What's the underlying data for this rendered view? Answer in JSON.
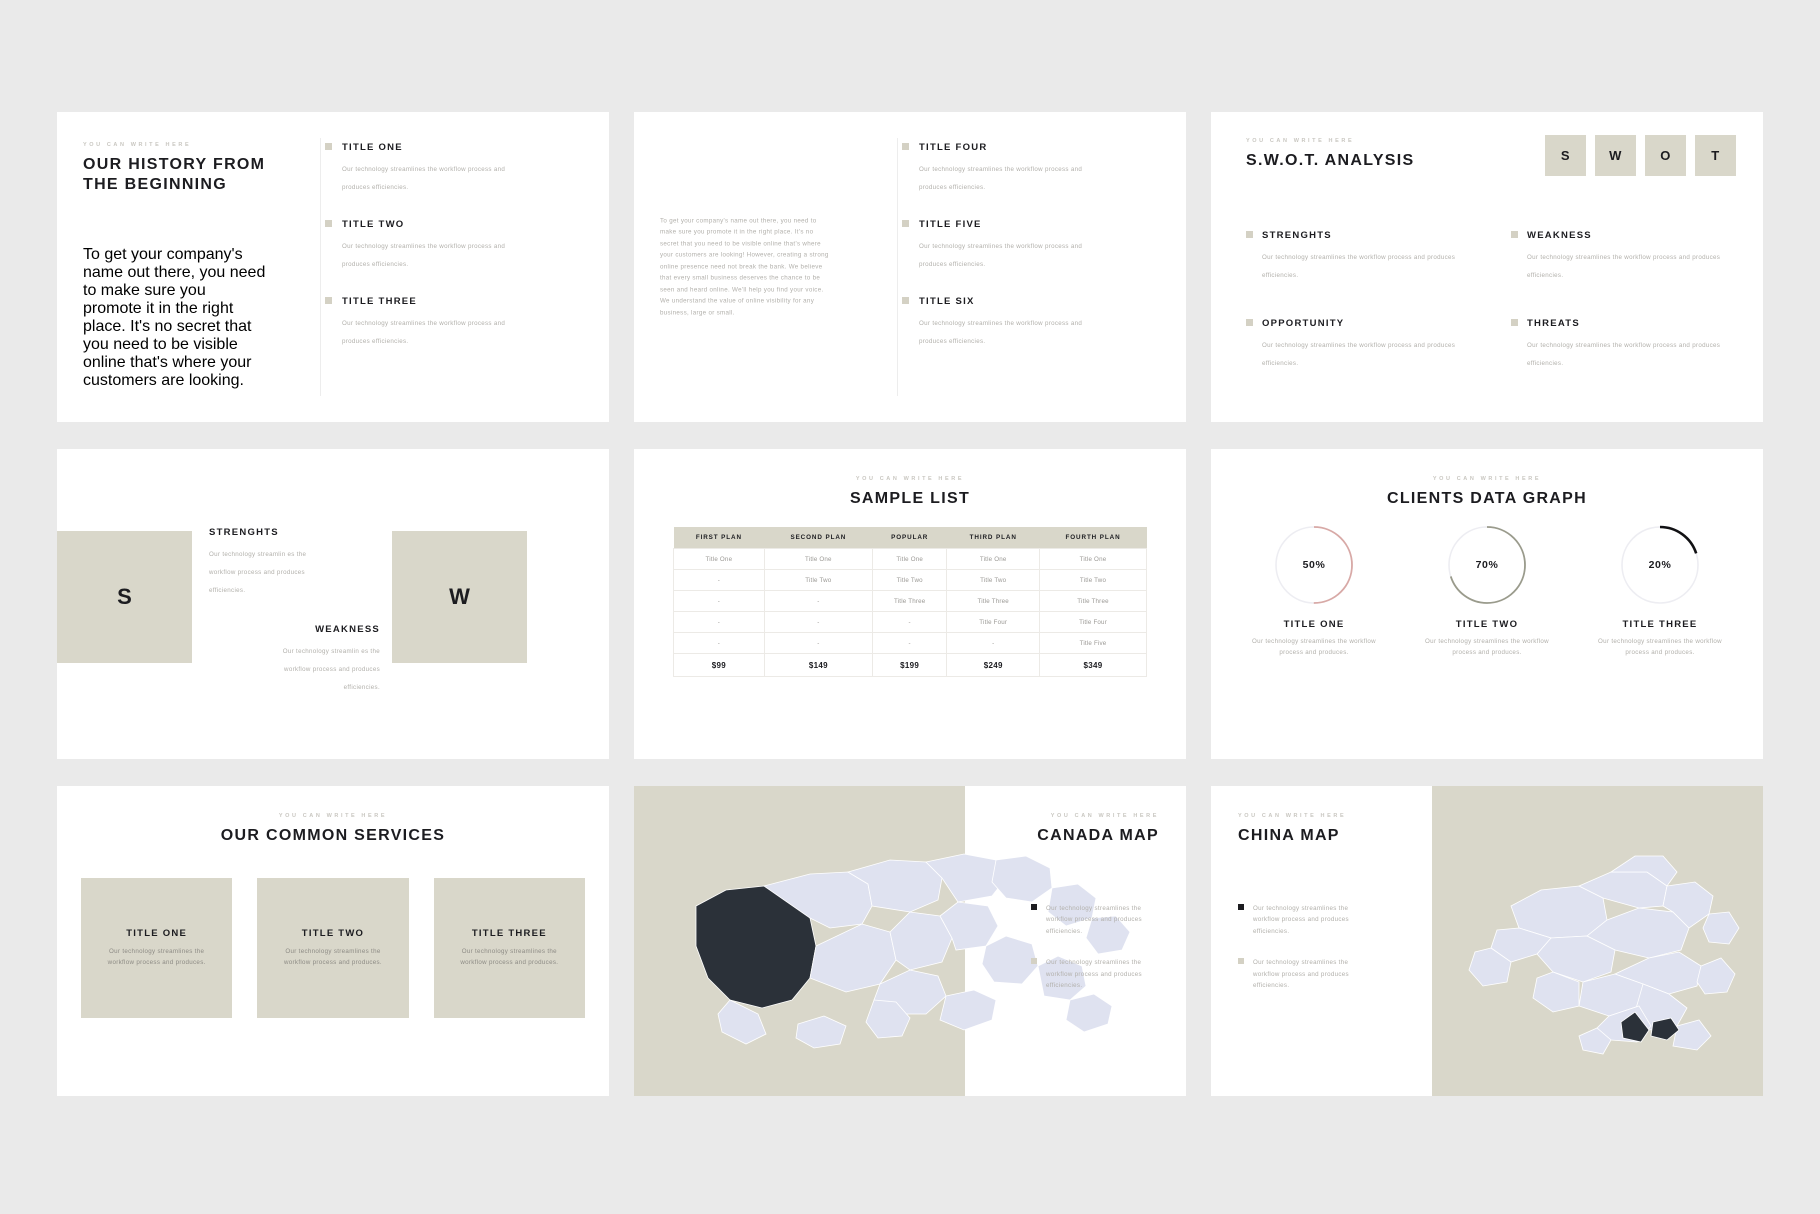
{
  "common": {
    "eyebrow": "YOU CAN WRITE HERE",
    "desc_short": "Our technology streamlines the workflow process and produces efficiencies.",
    "desc_nodot": "Our technology streamlines the workflow process and produces.",
    "desc_wrap": "Our technology streamlin es the workflow process and produces efficiencies.",
    "accent_beige": "#d9d7ca",
    "accent_dark": "#1c1c20",
    "text_muted": "#b2b0ab",
    "map_fill": "#dfe2f0"
  },
  "slide1": {
    "eyebrow": "YOU CAN WRITE HERE",
    "title": "OUR HISTORY FROM THE BEGINNING",
    "paragraph": "To get your company's name out there, you need to make sure you promote it in the right place. It's no secret that you need to be visible online that's where your customers are looking.",
    "features": [
      {
        "title": "TITLE ONE",
        "desc": "Our technology streamlines the workflow process and produces efficiencies."
      },
      {
        "title": "TITLE TWO",
        "desc": "Our technology streamlines the workflow process and produces efficiencies."
      },
      {
        "title": "TITLE THREE",
        "desc": "Our technology streamlines the workflow process and produces efficiencies."
      }
    ]
  },
  "slide2": {
    "paragraph": "To get your company's name out there, you need to make sure you promote it in the right place. It's no secret that you need to be visible online that's where your customers are looking! However, creating a strong online presence need not break the bank. We believe that every small business deserves the chance to be seen and heard online. We'll help you find your voice. We understand the value of online visibility for any business, large or small.",
    "features": [
      {
        "title": "TITLE FOUR",
        "desc": "Our technology streamlines the workflow process and produces efficiencies."
      },
      {
        "title": "TITLE FIVE",
        "desc": "Our technology streamlines the workflow process and produces efficiencies."
      },
      {
        "title": "TITLE SIX",
        "desc": "Our technology streamlines the workflow process and produces efficiencies."
      }
    ]
  },
  "slide3": {
    "eyebrow": "YOU CAN WRITE HERE",
    "title": "S.W.O.T. ANALYSIS",
    "boxes": [
      "S",
      "W",
      "O",
      "T"
    ],
    "cells": [
      {
        "title": "STRENGHTS",
        "desc": "Our technology streamlines the workflow process and produces efficiencies."
      },
      {
        "title": "WEAKNESS",
        "desc": "Our technology streamlines the workflow process and produces efficiencies."
      },
      {
        "title": "OPPORTUNITY",
        "desc": "Our technology streamlines the workflow process and produces efficiencies."
      },
      {
        "title": "THREATS",
        "desc": "Our technology streamlines the workflow process and produces efficiencies."
      }
    ]
  },
  "slide4": {
    "letter_a": "S",
    "letter_b": "W",
    "block_a": {
      "title": "STRENGHTS",
      "desc": "Our technology streamlin es the workflow process and produces efficiencies."
    },
    "block_b": {
      "title": "WEAKNESS",
      "desc": "Our technology streamlin es the workflow process and produces efficiencies."
    }
  },
  "slide5": {
    "eyebrow": "YOU CAN WRITE HERE",
    "title": "SAMPLE LIST",
    "table": {
      "headers": [
        "FIRST PLAN",
        "SECOND PLAN",
        "POPULAR",
        "THIRD PLAN",
        "FOURTH PLAN"
      ],
      "rows": [
        [
          "Title One",
          "Title One",
          "Title One",
          "Title One",
          "Title One"
        ],
        [
          "-",
          "Title Two",
          "Title Two",
          "Title Two",
          "Title Two"
        ],
        [
          "-",
          "-",
          "Title Three",
          "Title Three",
          "Title Three"
        ],
        [
          "-",
          "-",
          "-",
          "Title Four",
          "Title Four"
        ],
        [
          "-",
          "-",
          "-",
          "-",
          "Title Five"
        ]
      ],
      "prices": [
        "$99",
        "$149",
        "$199",
        "$249",
        "$349"
      ]
    }
  },
  "slide6": {
    "eyebrow": "YOU CAN WRITE HERE",
    "title": "CLIENTS DATA GRAPH",
    "chart_data": {
      "type": "pie",
      "title": "CLIENTS DATA GRAPH",
      "categories": [
        "TITLE ONE",
        "TITLE TWO",
        "TITLE THREE"
      ],
      "values": [
        50,
        70,
        20
      ],
      "value_labels": [
        "50%",
        "70%",
        "20%"
      ],
      "arc_colors": [
        "#d8a9a6",
        "#9a9b8c",
        "#111114"
      ],
      "track_color": "#ededf2",
      "ylim": [
        0,
        100
      ],
      "legend": "none",
      "grid": false
    },
    "items": [
      {
        "label": "TITLE ONE",
        "value": "50%",
        "desc": "Our technology streamlines the workflow process and produces."
      },
      {
        "label": "TITLE TWO",
        "value": "70%",
        "desc": "Our technology streamlines the workflow process and produces."
      },
      {
        "label": "TITLE THREE",
        "value": "20%",
        "desc": "Our technology streamlines the workflow process and produces."
      }
    ]
  },
  "slide7": {
    "eyebrow": "YOU CAN WRITE HERE",
    "title": "OUR COMMON SERVICES",
    "cards": [
      {
        "title": "TITLE ONE",
        "desc": "Our technology streamlines the workflow process and produces."
      },
      {
        "title": "TITLE TWO",
        "desc": "Our technology streamlines the workflow process and produces."
      },
      {
        "title": "TITLE THREE",
        "desc": "Our technology streamlines the workflow process and produces."
      }
    ]
  },
  "slide8": {
    "eyebrow": "YOU CAN WRITE HERE",
    "title": "CANADA MAP",
    "bullets": [
      "Our technology streamlines the workflow process and produces efficiencies.",
      "Our technology streamlines the workflow process and produces efficiencies."
    ]
  },
  "slide9": {
    "eyebrow": "YOU CAN WRITE HERE",
    "title": "CHINA MAP",
    "bullets": [
      "Our technology streamlines the workflow process and produces efficiencies.",
      "Our technology streamlines the workflow process and produces efficiencies."
    ]
  }
}
